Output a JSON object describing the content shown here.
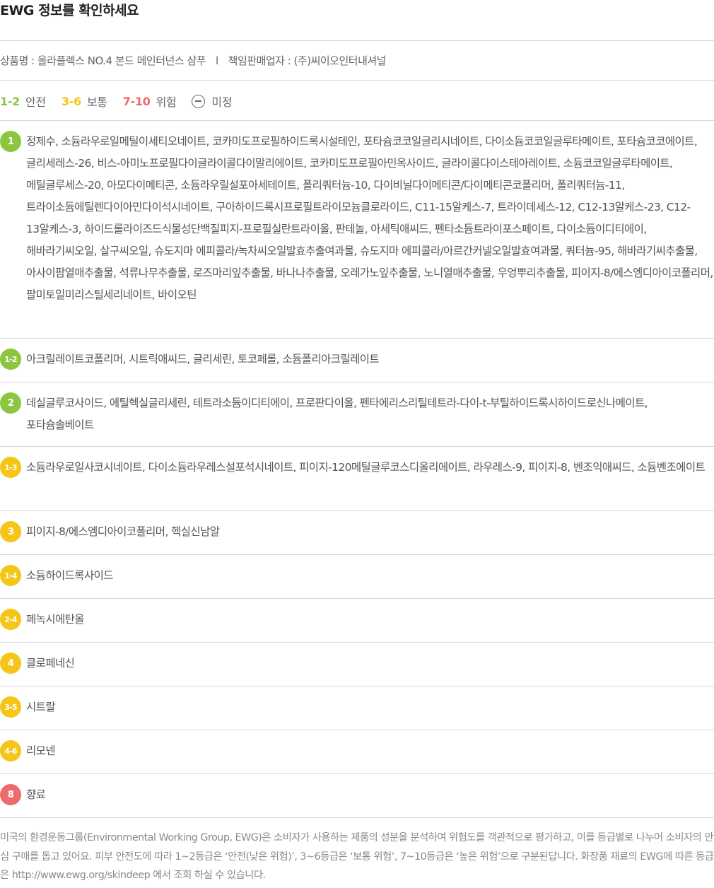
{
  "title": "EWG 정보를 확인하세요",
  "product": {
    "name": "상품명 : 올라플렉스 NO.4 본드 메인터넌스 샴푸",
    "separator": "l",
    "maker": "책임판매업자 : (주)씨이오인터내셔널"
  },
  "legend": [
    {
      "range": "1-2",
      "label": "안전",
      "color": "#8cc63f"
    },
    {
      "range": "3-6",
      "label": "보통",
      "color": "#f5c518"
    },
    {
      "range": "7-10",
      "label": "위험",
      "color": "#ee6b6b"
    },
    {
      "range": "",
      "label": "미정",
      "icon": "minus-circle-icon",
      "color": "#666666"
    }
  ],
  "colors": {
    "safe": "#8cc63f",
    "moderate": "#f5c518",
    "danger": "#ee6b6b"
  },
  "ingredient_groups": [
    {
      "grade": "1",
      "color": "#8cc63f",
      "ingredients": "정제수, 소듐라우로일메틸이세티오네이트, 코카미도프로필하이드록시설테인, 포타슘코코일글리시네이트, 다이소듐코코일글루타메이트, 포타슘코코에이트, 글리세레스-26, 비스-아미노프로필다이글라이콜다이말리에이트, 코카미도프로필아민옥사이드, 글라이콜다이스테아레이트, 소듐코코일글루타메이트, 메틸글루세스-20, 아모다이메티콘, 소듐라우릴설포아세테이트, 폴리쿼터늄-10, 다이비닐다이메티콘/다이메티콘코폴리머, 폴리쿼터늄-11, 트라이소듐에틸렌다이아민다이석시네이트, 구아하이드록시프로필트라이모늄클로라이드, C11-15알케스-7, 트라이데세스-12, C12-13알케스-23, C12-13알케스-3, 하이드롤라이즈드식물성단백질피지-프로필실란트라이올, 판테놀, 아세틱애씨드, 펜타소듐트라이포스페이트, 다이소듐이디티에이, 해바라기씨오일, 살구씨오일, 슈도지마 에피콜라/녹차씨오일발효추출여과물, 슈도지마 에피콜라/아르간커넬오일발효여과물, 쿼터늄-95, 해바라기씨추출물, 아사이팜열매추출물, 석류나무추출물, 로즈마리잎추출물, 바나나추출물, 오레가노잎추출물, 노니열매추출물, 우엉뿌리추출물, 피이지-8/에스엠디아이코폴리머, 팔미토일미리스틸세리네이트, 바이오틴"
    },
    {
      "grade": "1-2",
      "color": "#8cc63f",
      "ingredients": "아크릴레이트코폴리머, 시트릭애씨드, 글리세린, 토코페롤, 소듐폴리아크릴레이트"
    },
    {
      "grade": "2",
      "color": "#8cc63f",
      "ingredients": "데실글루코사이드, 에틸헥실글리세린, 테트라소듐이디티에이, 프로판다이올, 펜타에리스리틸테트라-다이-t-부틸하이드록시하이드로신나메이트, 포타슘솔베이트"
    },
    {
      "grade": "1-3",
      "color": "#f5c518",
      "ingredients": "소듐라우로일사코시네이트, 다이소듐라우레스설포석시네이트, 피이지-120메틸글루코스디올리에이트, 라우레스-9, 피이지-8, 벤조익애씨드, 소듐벤조에이트"
    },
    {
      "grade": "3",
      "color": "#f5c518",
      "ingredients": "피이지-8/에스엠디아이코폴리머, 헥실신남알"
    },
    {
      "grade": "1-4",
      "color": "#f5c518",
      "ingredients": "소듐하이드록사이드"
    },
    {
      "grade": "2-4",
      "color": "#f5c518",
      "ingredients": "페녹시에탄올"
    },
    {
      "grade": "4",
      "color": "#f5c518",
      "ingredients": "클로페네신"
    },
    {
      "grade": "3-5",
      "color": "#f5c518",
      "ingredients": "시트랄"
    },
    {
      "grade": "4-6",
      "color": "#f5c518",
      "ingredients": "리모넨"
    },
    {
      "grade": "8",
      "color": "#ee6b6b",
      "ingredients": "향료"
    }
  ],
  "footer": "미국의 환경운동그룹(Environmental Working Group, EWG)은 소비자가 사용하는 제품의 성분을 분석하여 위험도를 객관적으로 평가하고, 이를 등급별로 나누어 소비자의 안심 구매를 돕고 있어요. 피부 안전도에 따라 1~2등급은 ‘안전(낮은 위험)’, 3~6등급은 ‘보통 위험’, 7~10등급은 ‘높은 위험’으로 구분된답니다. 화장품 재료의 EWG에 따른 등급은 http://www.ewg.org/skindeep 에서 조회 하실 수 있습니다."
}
